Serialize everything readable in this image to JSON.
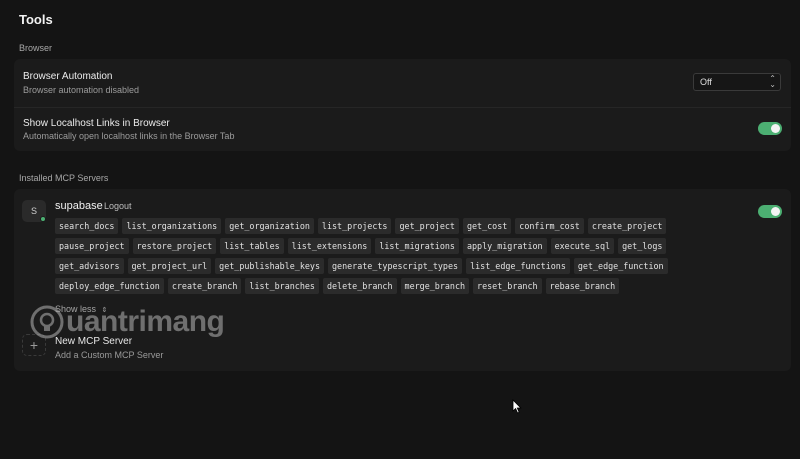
{
  "page": {
    "title": "Tools"
  },
  "browser_section": {
    "label": "Browser",
    "automation": {
      "title": "Browser Automation",
      "description": "Browser automation disabled",
      "select_value": "Off"
    },
    "localhost": {
      "title": "Show Localhost Links in Browser",
      "description": "Automatically open localhost links in the Browser Tab",
      "enabled": true
    }
  },
  "mcp_section": {
    "label": "Installed MCP Servers",
    "server": {
      "avatar_letter": "S",
      "name": "supabase",
      "logout_label": "Logout",
      "enabled": true,
      "tools": [
        "search_docs",
        "list_organizations",
        "get_organization",
        "list_projects",
        "get_project",
        "get_cost",
        "confirm_cost",
        "create_project",
        "pause_project",
        "restore_project",
        "list_tables",
        "list_extensions",
        "list_migrations",
        "apply_migration",
        "execute_sql",
        "get_logs",
        "get_advisors",
        "get_project_url",
        "get_publishable_keys",
        "generate_typescript_types",
        "list_edge_functions",
        "get_edge_function",
        "deploy_edge_function",
        "create_branch",
        "list_branches",
        "delete_branch",
        "merge_branch",
        "reset_branch",
        "rebase_branch"
      ],
      "show_less_label": "Show less"
    },
    "new_server": {
      "title": "New MCP Server",
      "description": "Add a Custom MCP Server"
    }
  },
  "watermark": {
    "text": "uantrimang"
  },
  "colors": {
    "toggle_on": "#4caf72",
    "background": "#141414",
    "card": "#1b1b1b"
  },
  "icons": {
    "select_chevrons": "chevron-up-down-icon",
    "show_less": "chevron-up-down-icon",
    "add": "plus-icon",
    "cursor": "mouse-pointer-icon"
  }
}
